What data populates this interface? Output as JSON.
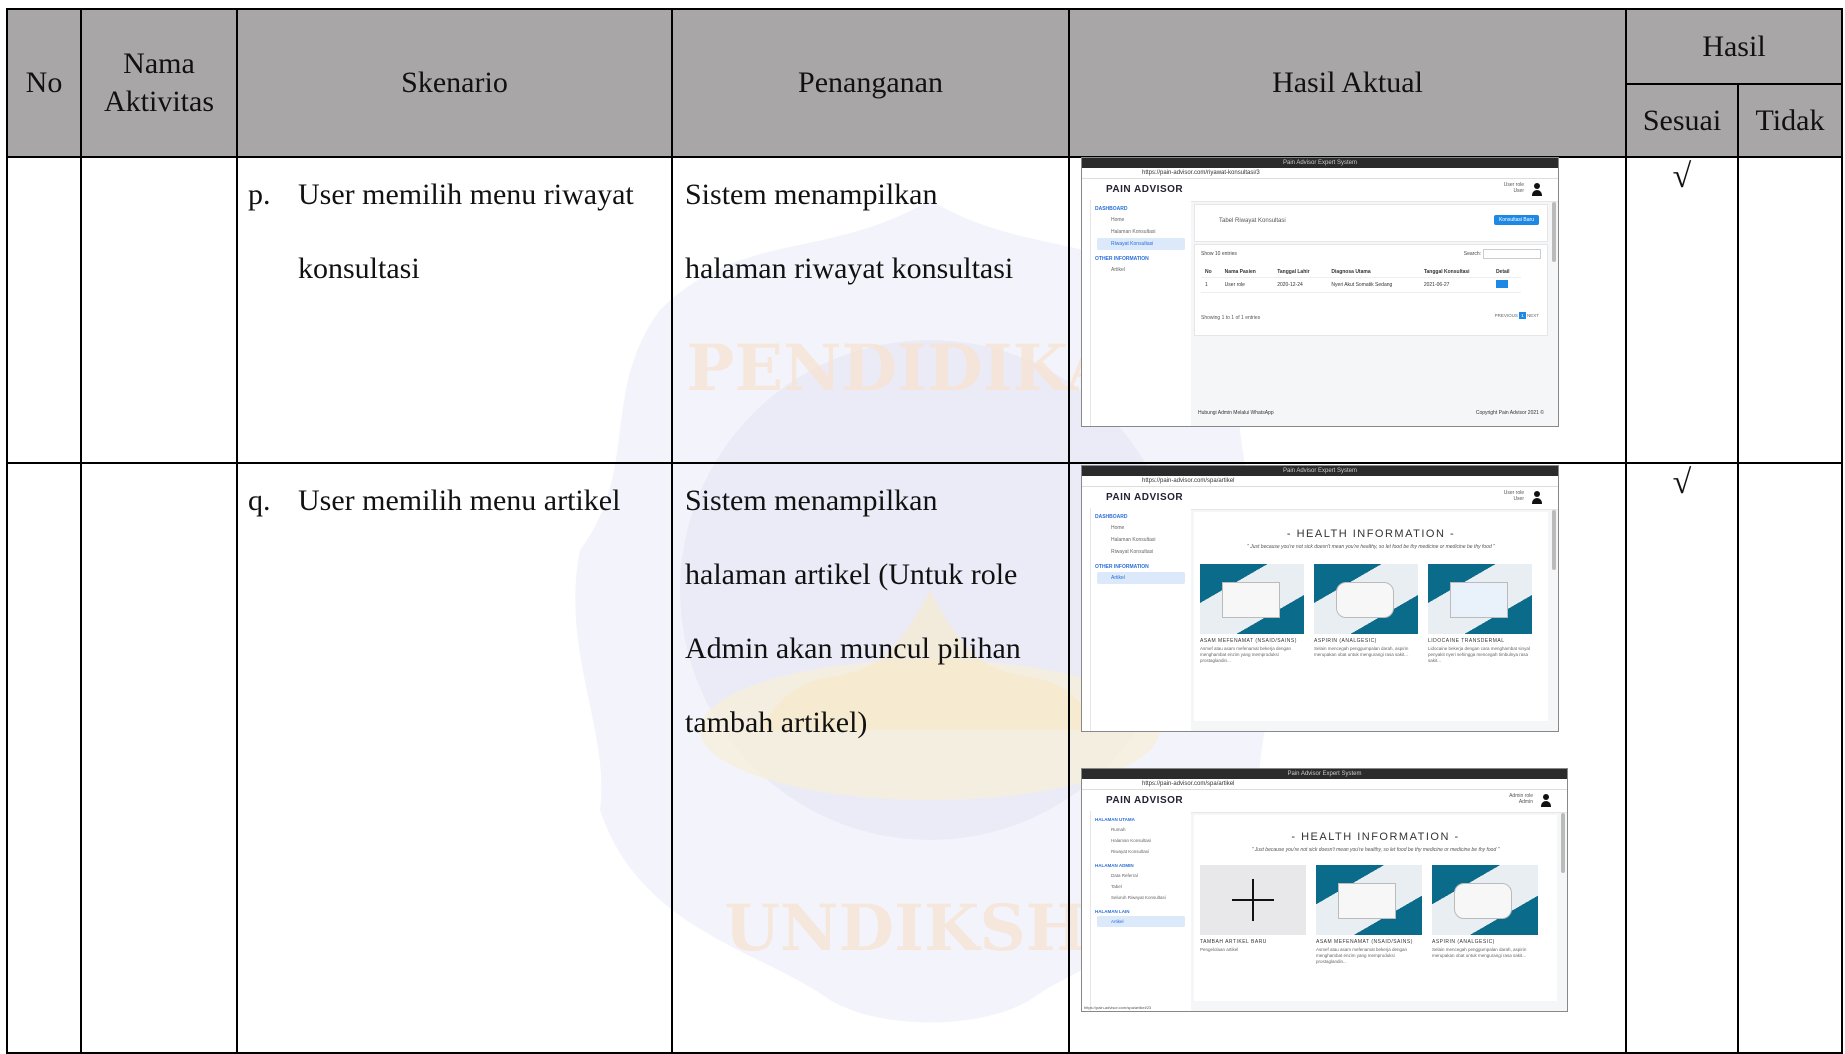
{
  "header": {
    "no": "No",
    "nama_aktivitas": [
      "Nama",
      "Aktivitas"
    ],
    "skenario": "Skenario",
    "penanganan": "Penanganan",
    "hasil_aktual": "Hasil Aktual",
    "hasil": "Hasil",
    "sesuai": "Sesuai",
    "tidak": "Tidak"
  },
  "rows": [
    {
      "label": "p.",
      "skenario_lines": [
        "User memilih menu riwayat",
        "konsultasi"
      ],
      "penanganan_lines": [
        "Sistem menampilkan",
        "halaman riwayat konsultasi"
      ],
      "sesuai": "√"
    },
    {
      "label": "q.",
      "skenario_lines": [
        "User memilih menu artikel"
      ],
      "penanganan_lines": [
        "Sistem menampilkan",
        "halaman artikel (Untuk role",
        "Admin akan muncul pilihan",
        "tambah artikel)"
      ],
      "sesuai": "√"
    }
  ],
  "shot1": {
    "window_title": "Pain Advisor Expert System",
    "url": "https://pain-advisor.com/riyawat-konsultasi/3",
    "logo": "PAIN ADVISOR",
    "user": [
      "User role",
      "User"
    ],
    "sidebar": [
      "DASHBOARD",
      "Home",
      "Halaman Konsultasi",
      "Riwayat Konsultasi",
      "OTHER INFORMATION",
      "Artikel"
    ],
    "title": "Tabel Riwayat Konsultasi",
    "button": "Konsultasi Baru",
    "show": "Show 10 entries",
    "search": "Search:",
    "columns": [
      "No",
      "Nama Pasien",
      "Tanggal Lahir",
      "Diagnosa Utama",
      "Tanggal Konsultasi",
      "Detail"
    ],
    "row": [
      "1",
      "User role",
      "2020-12-24",
      "Nyeri Akut Somatik Sedang",
      "2021-06-27",
      ""
    ],
    "showing": "Showing 1 to 1 of 1 entries",
    "pager": [
      "PREVIOUS",
      "1",
      "NEXT"
    ],
    "footer_left": "Hubungi Admin Melalui WhatsApp",
    "footer_right": "Copyright Pain Advisor 2021 ©"
  },
  "shot2": {
    "window_title": "Pain Advisor Expert System",
    "url": "https://pain-advisor.com/spa/artikel",
    "logo": "PAIN ADVISOR",
    "user": [
      "User role",
      "User"
    ],
    "sidebar": [
      "DASHBOARD",
      "Home",
      "Halaman Konsultasi",
      "Riwayat Konsultasi",
      "OTHER INFORMATION",
      "Artikel"
    ],
    "heading": "- HEALTH INFORMATION -",
    "quote": "\" Just because you're not sick doesn't mean you're healthy, so let food be thy medicine or medicine be thy food \"",
    "cards": [
      {
        "title": "ASAM MEFENAMAT (NSAID/SAINS)",
        "desc": "Asmef atau asam mefenamat bekerja dengan menghambat enzim yang memproduksi prostaglandin..."
      },
      {
        "title": "ASPIRIN (ANALGESIC)",
        "desc": "Selain mencegah penggumpalan darah, aspirin merupakan obat untuk mengurangi rasa sakit..."
      },
      {
        "title": "LIDOCAINE TRANSDERMAL",
        "desc": "Lidocaine bekerja dengan cara menghambat sinyal penyakit nyeri sehingga mencegah timbulnya rasa sakit..."
      }
    ]
  },
  "shot3": {
    "window_title": "Pain Advisor Expert System",
    "url": "https://pain-advisor.com/spa/artikel",
    "logo": "PAIN ADVISOR",
    "user": [
      "Admin role",
      "Admin"
    ],
    "sidebar": [
      "HALAMAN UTAMA",
      "Rumah",
      "Halaman Konsultasi",
      "Riwayat Konsultasi",
      "HALAMAN ADMIN",
      "Data Referral",
      "Tabel",
      "Seluruh Riwayat Konsultasi",
      "HALAMAN LAIN",
      "Artikel"
    ],
    "heading": "- HEALTH INFORMATION -",
    "quote": "\" Just because you're not sick doesn't mean you're healthy, so let food be thy medicine or medicine be thy food \"",
    "cards": [
      {
        "title": "TAMBAH ARTIKEL BARU",
        "desc": "Pengelolaan artikel"
      },
      {
        "title": "ASAM MEFENAMAT (NSAID/SAINS)",
        "desc": "Asmef atau asam mefenamat bekerja dengan menghambat enzim yang memproduksi prostaglandin..."
      },
      {
        "title": "ASPIRIN (ANALGESIC)",
        "desc": "Selain mencegah penggumpalan darah, aspirin merupakan obat untuk mengurangi rasa sakit..."
      }
    ],
    "status_url": "https://pain-advisor.com/spa/artikel/23"
  }
}
